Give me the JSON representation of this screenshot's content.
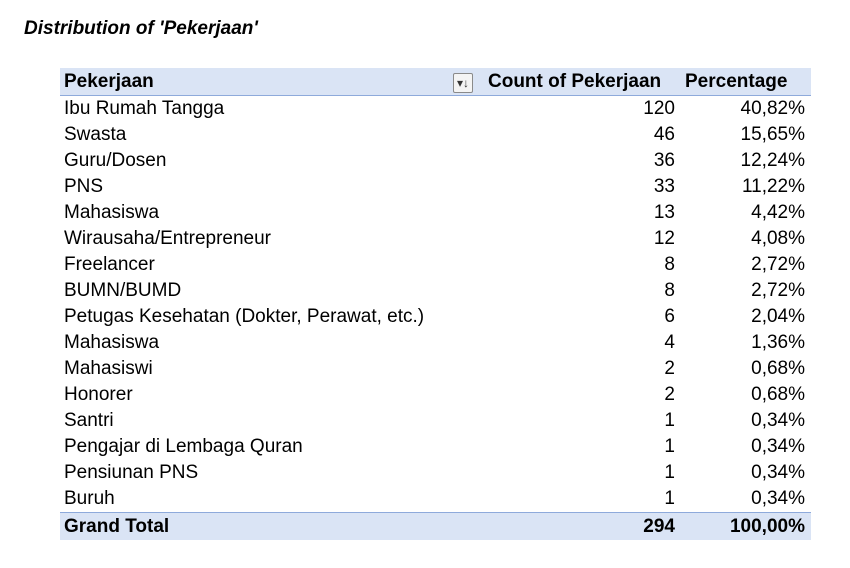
{
  "title": "Distribution of 'Pekerjaan'",
  "table": {
    "headers": {
      "name": "Pekerjaan",
      "count": "Count of Pekerjaan",
      "percentage": "Percentage"
    },
    "sort_icon": "sort-filter-icon",
    "rows": [
      {
        "name": "Ibu Rumah Tangga",
        "count": "120",
        "percentage": "40,82%"
      },
      {
        "name": "Swasta",
        "count": "46",
        "percentage": "15,65%"
      },
      {
        "name": "Guru/Dosen",
        "count": "36",
        "percentage": "12,24%"
      },
      {
        "name": "PNS",
        "count": "33",
        "percentage": "11,22%"
      },
      {
        "name": "Mahasiswa",
        "count": "13",
        "percentage": "4,42%"
      },
      {
        "name": "Wirausaha/Entrepreneur",
        "count": "12",
        "percentage": "4,08%"
      },
      {
        "name": "Freelancer",
        "count": "8",
        "percentage": "2,72%"
      },
      {
        "name": "BUMN/BUMD",
        "count": "8",
        "percentage": "2,72%"
      },
      {
        "name": "Petugas Kesehatan (Dokter, Perawat, etc.)",
        "count": "6",
        "percentage": "2,04%"
      },
      {
        "name": "Mahasiswa",
        "count": "4",
        "percentage": "1,36%"
      },
      {
        "name": "Mahasiswi",
        "count": "2",
        "percentage": "0,68%"
      },
      {
        "name": "Honorer",
        "count": "2",
        "percentage": "0,68%"
      },
      {
        "name": "Santri",
        "count": "1",
        "percentage": "0,34%"
      },
      {
        "name": "Pengajar di Lembaga Quran",
        "count": "1",
        "percentage": "0,34%"
      },
      {
        "name": "Pensiunan PNS",
        "count": "1",
        "percentage": "0,34%"
      },
      {
        "name": "Buruh",
        "count": "1",
        "percentage": "0,34%"
      }
    ],
    "total": {
      "name": "Grand Total",
      "count": "294",
      "percentage": "100,00%"
    }
  },
  "colors": {
    "header_fill": "#dae4f5",
    "border": "#8eaadb"
  }
}
